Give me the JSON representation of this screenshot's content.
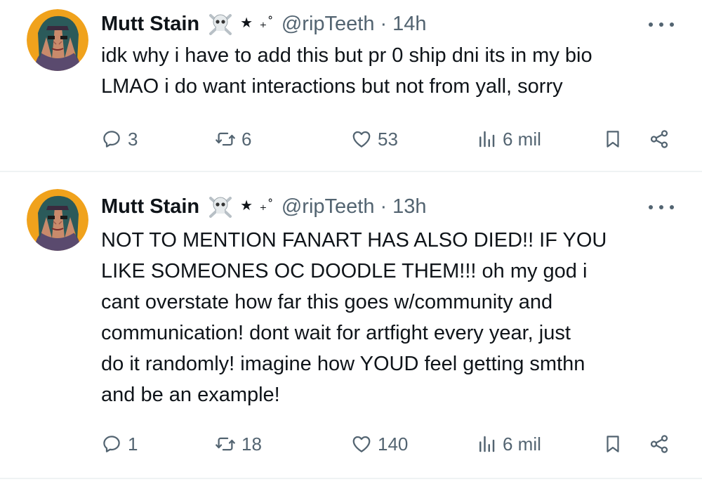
{
  "tweets": [
    {
      "author": {
        "name": "Mutt Stain",
        "deco_stars": "★ ₊˚",
        "handle": "@ripTeeth"
      },
      "separator": "·",
      "time": "14h",
      "lines": [
        "idk why i have to add this but pr 0 ship dni its in my bio",
        "LMAO i do want interactions but not from yall, sorry"
      ],
      "stats": {
        "replies": "3",
        "reposts": "6",
        "likes": "53",
        "views": "6 mil"
      }
    },
    {
      "author": {
        "name": "Mutt Stain",
        "deco_stars": "★ ₊˚",
        "handle": "@ripTeeth"
      },
      "separator": "·",
      "time": "13h",
      "lines": [
        "NOT TO MENTION FANART HAS ALSO DIED!! IF YOU",
        "LIKE SOMEONES OC DOODLE THEM!!! oh my god i",
        "cant overstate how far this goes w/community and",
        "communication! dont wait for artfight every year, just",
        "do it randomly! imagine how YOUD feel getting smthn",
        "and be an example!"
      ],
      "stats": {
        "replies": "1",
        "reposts": "18",
        "likes": "140",
        "views": "6 mil"
      }
    }
  ],
  "icons": {
    "reply": "reply-icon",
    "repost": "repost-icon",
    "like": "heart-icon",
    "views": "views-icon",
    "bookmark": "bookmark-icon",
    "share": "share-icon",
    "more": "more-icon",
    "skull": "skull-crossbones-icon"
  },
  "colors": {
    "text": "#0f1419",
    "muted": "#536471",
    "divider": "#eff3f4"
  }
}
